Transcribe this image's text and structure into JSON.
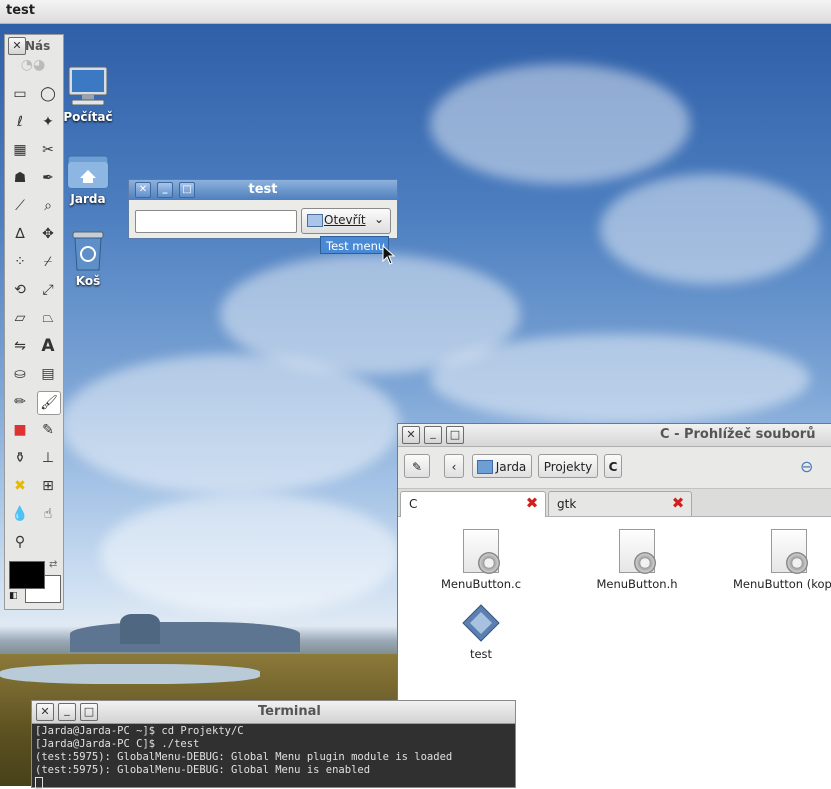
{
  "app_title": "test",
  "desktop_icons": [
    "Počítač",
    "Jarda",
    "Koš"
  ],
  "toolbox": {
    "title": "Nás"
  },
  "test_window": {
    "title": "test",
    "input_value": "",
    "open_button": "Otevřít",
    "menu_item": "Test menu"
  },
  "file_browser": {
    "title": "C - Prohlížeč souborů",
    "path": [
      "Jarda",
      "Projekty",
      "C"
    ],
    "tabs": [
      "C",
      "gtk"
    ],
    "files": [
      "MenuButton.c",
      "MenuButton.h",
      "MenuButton (kopi",
      "test"
    ]
  },
  "terminal": {
    "title": "Terminal",
    "lines": [
      "[Jarda@Jarda-PC ~]$ cd Projekty/C",
      "[Jarda@Jarda-PC C]$ ./test",
      "(test:5975): GlobalMenu-DEBUG: Global Menu plugin module is loaded",
      "(test:5975): GlobalMenu-DEBUG: Global Menu is enabled"
    ]
  }
}
